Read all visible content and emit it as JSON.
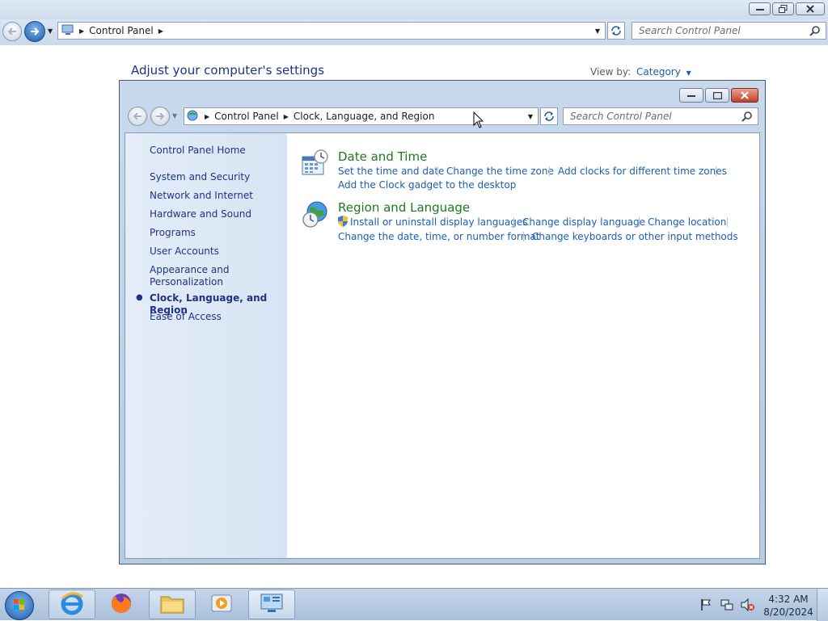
{
  "background_window": {
    "breadcrumb": [
      "Control Panel"
    ],
    "search_placeholder": "Search Control Panel",
    "heading": "Adjust your computer's settings",
    "view_by_label": "View by:",
    "view_by_value": "Category"
  },
  "window": {
    "breadcrumb": [
      "Control Panel",
      "Clock, Language, and Region"
    ],
    "search_placeholder": "Search Control Panel",
    "sidebar": {
      "home": "Control Panel Home",
      "items": [
        {
          "label": "System and Security"
        },
        {
          "label": "Network and Internet"
        },
        {
          "label": "Hardware and Sound"
        },
        {
          "label": "Programs"
        },
        {
          "label": "User Accounts"
        },
        {
          "label": "Appearance and Personalization"
        },
        {
          "label": "Clock, Language, and Region",
          "active": true
        },
        {
          "label": "Ease of Access"
        }
      ]
    },
    "categories": [
      {
        "title": "Date and Time",
        "icon": "calendar-clock-icon",
        "links": [
          "Set the time and date",
          "Change the time zone",
          "Add clocks for different time zones",
          "Add the Clock gadget to the desktop"
        ]
      },
      {
        "title": "Region and Language",
        "icon": "globe-clock-icon",
        "links": [
          "Install or uninstall display languages",
          "Change display language",
          "Change location",
          "Change the date, time, or number format",
          "Change keyboards or other input methods"
        ]
      }
    ]
  },
  "taskbar": {
    "pinned": [
      "internet-explorer-icon",
      "firefox-icon",
      "file-explorer-icon",
      "media-player-icon",
      "control-panel-icon"
    ],
    "time": "4:32 AM",
    "date": "8/20/2024"
  },
  "colors": {
    "link": "#1a5fb4",
    "category_title": "#1e7b1e",
    "heading": "#1e3287"
  }
}
